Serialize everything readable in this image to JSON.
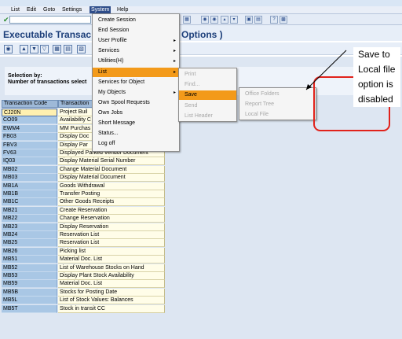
{
  "app": {
    "menu": [
      "List",
      "Edit",
      "Goto",
      "Settings",
      "System",
      "Help"
    ],
    "active_menu": "System",
    "title": "Executable Transac",
    "title_suffix": "Options )"
  },
  "selection": {
    "line1": "Selection by:",
    "line2": "Number of transactions select"
  },
  "table": {
    "headers": [
      "Transaction Code",
      "Transaction"
    ],
    "rows": [
      {
        "code": "CJ20N",
        "text": "Project Buil"
      },
      {
        "code": "CO09",
        "text": "Availability C"
      },
      {
        "code": "EWM4",
        "text": "MM Purchas"
      },
      {
        "code": "FB03",
        "text": "Display Doc"
      },
      {
        "code": "FBV3",
        "text": "Display Par"
      },
      {
        "code": "FV63",
        "text": "Displayed Parked Vendor Document"
      },
      {
        "code": "IQ03",
        "text": "Display Material Serial Number"
      },
      {
        "code": "MB02",
        "text": "Change Material Document"
      },
      {
        "code": "MB03",
        "text": "Display Material Document"
      },
      {
        "code": "MB1A",
        "text": "Goods Withdrawal"
      },
      {
        "code": "MB1B",
        "text": "Transfer Posting"
      },
      {
        "code": "MB1C",
        "text": "Other Goods Receipts"
      },
      {
        "code": "MB21",
        "text": "Create Reservation"
      },
      {
        "code": "MB22",
        "text": "Change Reservation"
      },
      {
        "code": "MB23",
        "text": "Display Reservation"
      },
      {
        "code": "MB24",
        "text": "Reservation List"
      },
      {
        "code": "MB25",
        "text": "Reservation List"
      },
      {
        "code": "MB26",
        "text": "Picking list"
      },
      {
        "code": "MB51",
        "text": "Material Doc. List"
      },
      {
        "code": "MB52",
        "text": "List of Warehouse Stocks on Hand"
      },
      {
        "code": "MB53",
        "text": "Display Plant Stock Availability"
      },
      {
        "code": "MB59",
        "text": "Material Doc. List"
      },
      {
        "code": "MB5B",
        "text": "Stocks for Posting Date"
      },
      {
        "code": "MB5L",
        "text": "List of Stock Values: Balances"
      },
      {
        "code": "MB5T",
        "text": "Stock in transit CC"
      }
    ]
  },
  "system_menu": [
    {
      "label": "Create Session",
      "disabled": false,
      "sub": false
    },
    {
      "label": "End Session",
      "disabled": false,
      "sub": false
    },
    {
      "label": "User Profile",
      "disabled": false,
      "sub": true
    },
    {
      "label": "Services",
      "disabled": false,
      "sub": true
    },
    {
      "label": "Utilities(H)",
      "disabled": false,
      "sub": true
    },
    {
      "label": "List",
      "disabled": false,
      "sub": true,
      "highlight": true
    },
    {
      "label": "Services for Object",
      "disabled": false,
      "sub": false
    },
    {
      "label": "My Objects",
      "disabled": false,
      "sub": true
    },
    {
      "label": "Own Spool Requests",
      "disabled": false,
      "sub": false
    },
    {
      "label": "Own Jobs",
      "disabled": false,
      "sub": false
    },
    {
      "label": "Short Message",
      "disabled": false,
      "sub": false
    },
    {
      "label": "Status...",
      "disabled": false,
      "sub": false
    },
    {
      "label": "Log off",
      "disabled": false,
      "sub": false
    }
  ],
  "list_menu": [
    {
      "label": "Print",
      "disabled": true
    },
    {
      "label": "Find...",
      "disabled": true
    },
    {
      "label": "Save",
      "disabled": false,
      "highlight": true
    },
    {
      "label": "Send",
      "disabled": true
    },
    {
      "label": "List Header",
      "disabled": true
    }
  ],
  "save_menu": [
    {
      "label": "Office Folders",
      "disabled": true
    },
    {
      "label": "Report Tree",
      "disabled": true
    },
    {
      "label": "Local File",
      "disabled": true
    }
  ],
  "annotation": {
    "lines": [
      "Save to",
      "Local file",
      "option is",
      "disabled"
    ],
    "highlight_color": "#e1221b"
  },
  "colors": {
    "menu_highlight": "#f39a1a",
    "code_column": "#a9c7e5",
    "text_column": "#fffde8"
  }
}
